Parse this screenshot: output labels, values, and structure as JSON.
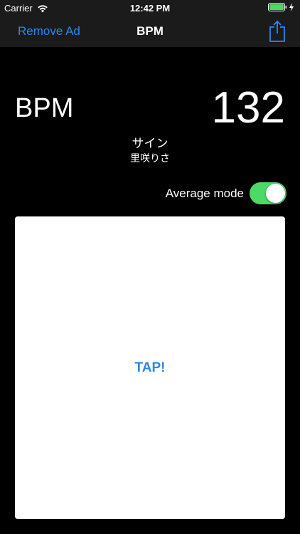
{
  "status_bar": {
    "carrier": "Carrier",
    "time": "12:42 PM",
    "battery_level": 1.0
  },
  "nav": {
    "left_button": "Remove Ad",
    "title": "BPM",
    "right_icon": "share-icon"
  },
  "main": {
    "bpm_label": "BPM",
    "bpm_value": "132",
    "song_title": "サイン",
    "song_artist": "里咲りさ",
    "average_mode_label": "Average mode",
    "average_mode_on": true,
    "tap_label": "TAP!"
  },
  "colors": {
    "accent": "#2f86e8",
    "toggle_on": "#4cd964",
    "battery": "#4cd964",
    "nav_background": "#1b1b1b",
    "background": "#000000"
  }
}
